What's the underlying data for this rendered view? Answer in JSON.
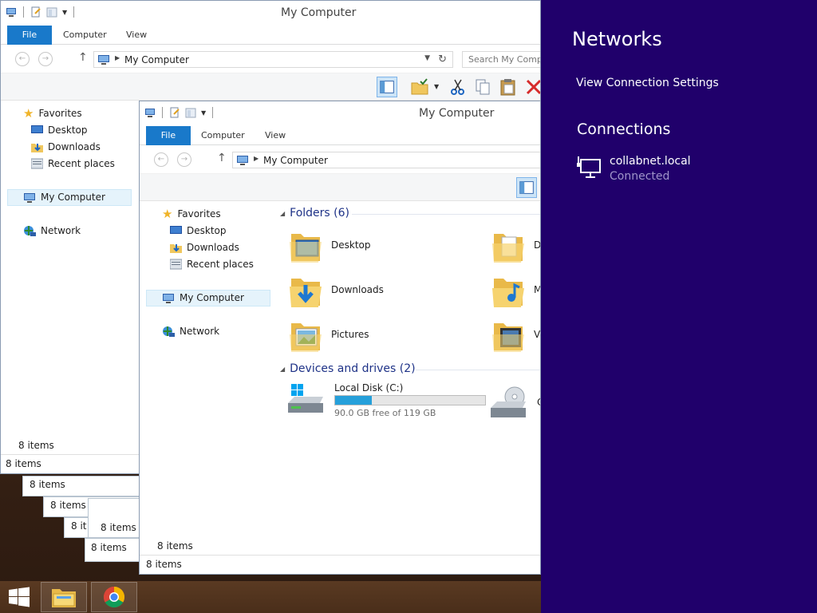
{
  "back_window": {
    "title": "My Computer",
    "tabs": [
      "File",
      "Computer",
      "View"
    ],
    "address": "My Computer",
    "search_placeholder": "Search My Comp",
    "nav": {
      "favorites": "Favorites",
      "desktop": "Desktop",
      "downloads": "Downloads",
      "recent": "Recent places",
      "computer": "My Computer",
      "network": "Network"
    },
    "status_inner": "8 items",
    "status": "8 items"
  },
  "stacked_status": [
    "8 items",
    "8 items",
    "8 it",
    "8 items",
    "8 items"
  ],
  "front_window": {
    "title": "My Computer",
    "tabs": [
      "File",
      "Computer",
      "View"
    ],
    "address": "My Computer",
    "nav": {
      "favorites": "Favorites",
      "desktop": "Desktop",
      "downloads": "Downloads",
      "recent": "Recent places",
      "computer": "My Computer",
      "network": "Network"
    },
    "folders_header": "Folders (6)",
    "folders": [
      "Desktop",
      "Downloads",
      "Pictures"
    ],
    "folders_clipped": [
      "Do",
      "M",
      "Vi"
    ],
    "devices_header": "Devices and drives (2)",
    "drive": {
      "name": "Local Disk (C:)",
      "free_text": "90.0 GB free of 119 GB",
      "used_fraction": 0.244
    },
    "cd_clipped": "CI",
    "status_inner": "8 items",
    "status": "8 items"
  },
  "charm": {
    "title": "Networks",
    "link": "View Connection Settings",
    "section": "Connections",
    "connection_name": "collabnet.local",
    "connection_status": "Connected"
  },
  "colors": {
    "charm_bg": "#20006b",
    "accent": "#1979ca",
    "drive_fill": "#26a0da"
  },
  "taskbar": {
    "items": [
      "start-icon",
      "file-explorer-icon",
      "chrome-icon"
    ]
  }
}
